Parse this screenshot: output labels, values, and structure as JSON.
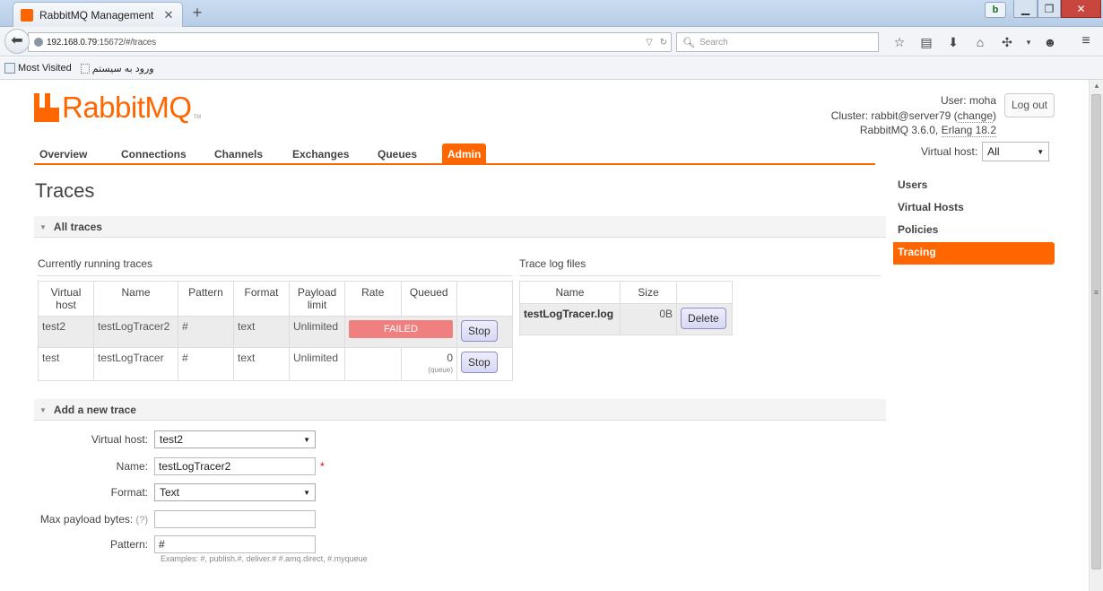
{
  "browser": {
    "tab_title": "RabbitMQ Management",
    "url_host": "192.168.0.79",
    "url_rest": ":15672/#/traces",
    "search_placeholder": "Search",
    "bookmarks": [
      "Most Visited",
      "ورود به سیستم"
    ]
  },
  "header": {
    "logo_text": "RabbitMQ",
    "logo_tm": "TM",
    "user_label": "User:",
    "user_name": "moha",
    "cluster_label": "Cluster:",
    "cluster_name": "rabbit@server79",
    "change_link": "change",
    "version_prefix": "RabbitMQ 3.6.0,",
    "erlang_version": "Erlang 18.2",
    "logout_label": "Log out",
    "vhost_label": "Virtual host:",
    "vhost_value": "All"
  },
  "nav": {
    "tabs": [
      "Overview",
      "Connections",
      "Channels",
      "Exchanges",
      "Queues",
      "Admin"
    ],
    "active": "Admin"
  },
  "page_title": "Traces",
  "side_menu": {
    "items": [
      "Users",
      "Virtual Hosts",
      "Policies",
      "Tracing"
    ],
    "active": "Tracing"
  },
  "all_traces": {
    "section_title": "All traces",
    "running_title": "Currently running traces",
    "columns": [
      "Virtual host",
      "Name",
      "Pattern",
      "Format",
      "Payload limit",
      "Rate",
      "Queued"
    ],
    "rows": [
      {
        "vhost": "test2",
        "name": "testLogTracer2",
        "pattern": "#",
        "format": "text",
        "payload": "Unlimited",
        "rate_status": "FAILED",
        "queued": "",
        "queued_sub": "",
        "action": "Stop"
      },
      {
        "vhost": "test",
        "name": "testLogTracer",
        "pattern": "#",
        "format": "text",
        "payload": "Unlimited",
        "rate_status": "",
        "queued": "0",
        "queued_sub": "(queue)",
        "action": "Stop"
      }
    ],
    "files_title": "Trace log files",
    "file_columns": [
      "Name",
      "Size"
    ],
    "files": [
      {
        "name": "testLogTracer.log",
        "size": "0B",
        "action": "Delete"
      }
    ]
  },
  "add_trace": {
    "section_title": "Add a new trace",
    "vhost_label": "Virtual host:",
    "vhost_value": "test2",
    "name_label": "Name:",
    "name_value": "testLogTracer2",
    "required_mark": "*",
    "format_label": "Format:",
    "format_value": "Text",
    "max_payload_label": "Max payload bytes:",
    "help_mark": "(?)",
    "max_payload_value": "",
    "pattern_label": "Pattern:",
    "pattern_value": "#",
    "pattern_hint": "Examples: #, publish.#, deliver.# #.amq.direct, #.myqueue"
  }
}
